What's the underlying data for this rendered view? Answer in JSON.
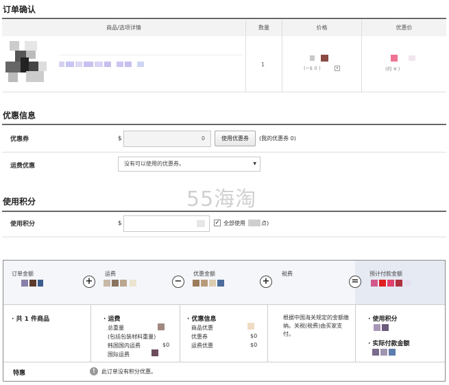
{
  "order": {
    "section_title": "订单确认",
    "columns": {
      "product": "商品/选项详情",
      "quantity": "数量",
      "price": "价格",
      "discount_price": "优惠价"
    },
    "row": {
      "quantity": "1",
      "price_paren": "(~$ 0 )",
      "discount_paren": "(约 ¥ )"
    }
  },
  "coupon": {
    "section_title": "优惠信息",
    "coupon_label": "优惠券",
    "currency": "$",
    "coupon_value": "0",
    "use_coupon_button": "使用优惠券",
    "my_coupon_text": "(我的优惠券 0)",
    "shipping_label": "运费优惠",
    "shipping_select": "没有可以使用的优惠券。"
  },
  "watermark": "55海淘",
  "points": {
    "section_title": "使用积分",
    "points_label": "使用积分",
    "currency": "$",
    "use_all_label": "全部使用",
    "use_all_suffix": "点)"
  },
  "summary": {
    "order_amount": "订单金额",
    "shipping": "运费",
    "discount_amount": "优惠金额",
    "tax": "税费",
    "estimated_payment": "预计付款金额",
    "ops": {
      "plus1": "+",
      "minus": "−",
      "plus2": "+",
      "equals": "="
    },
    "items_count_text": "· 共 1 件商品",
    "shipping_detail": {
      "head": "· 运费",
      "total_weight": "总重量",
      "weight_note": "(包括包装材料重量)",
      "korea_domestic": "韩国国内运费",
      "korea_domestic_val": "$0",
      "international": "国际运费"
    },
    "discount_detail": {
      "head": "· 优惠信息",
      "product_discount": "商品优惠",
      "coupon": "优惠券",
      "coupon_val": "$0",
      "shipping_coupon": "运费优惠",
      "shipping_coupon_val": "$0"
    },
    "tax_note": "根据中国海关规定的金额缴纳。关税(税费)由买家支付。",
    "points_used": "· 使用积分",
    "actual_payment": "· 实际付款金额"
  },
  "special": {
    "label": "特惠",
    "info_icon": "info-circle-icon",
    "text": "此订单没有积分优惠。"
  }
}
